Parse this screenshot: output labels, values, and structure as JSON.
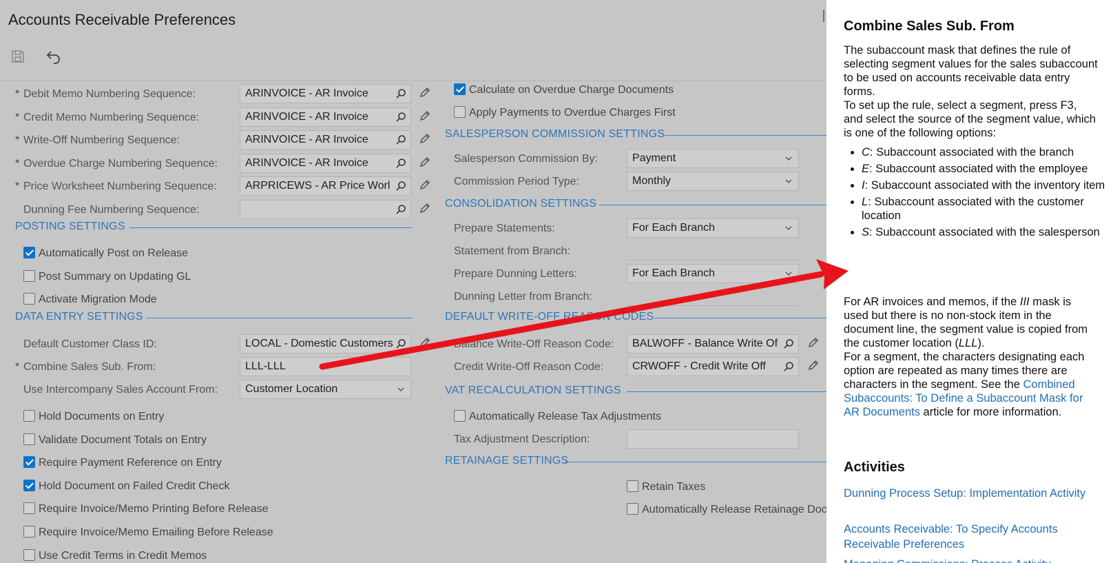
{
  "page": {
    "title": "Accounts Receivable Preferences"
  },
  "toolbar": {
    "save_icon": "save-icon",
    "undo_icon": "undo-icon"
  },
  "numbering": [
    {
      "label": "Debit Memo Numbering Sequence:",
      "required": true,
      "value": "ARINVOICE - AR Invoice"
    },
    {
      "label": "Credit Memo Numbering Sequence:",
      "required": true,
      "value": "ARINVOICE - AR Invoice"
    },
    {
      "label": "Write-Off Numbering Sequence:",
      "required": true,
      "value": "ARINVOICE - AR Invoice"
    },
    {
      "label": "Overdue Charge Numbering Sequence:",
      "required": true,
      "value": "ARINVOICE - AR Invoice"
    },
    {
      "label": "Price Worksheet Numbering Sequence:",
      "required": true,
      "value": "ARPRICEWS - AR Price Worl"
    },
    {
      "label": "Dunning Fee Numbering Sequence:",
      "required": false,
      "value": ""
    }
  ],
  "posting": {
    "title": "POSTING SETTINGS",
    "items": [
      {
        "label": "Automatically Post on Release",
        "checked": true
      },
      {
        "label": "Post Summary on Updating GL",
        "checked": false
      },
      {
        "label": "Activate Migration Mode",
        "checked": false
      }
    ]
  },
  "data_entry": {
    "title": "DATA ENTRY SETTINGS",
    "default_class_label": "Default Customer Class ID:",
    "default_class_value": "LOCAL - Domestic Customers",
    "combine_label": "Combine Sales Sub. From:",
    "combine_value": "LLL-LLL",
    "intercompany_label": "Use Intercompany Sales Account From:",
    "intercompany_value": "Customer Location",
    "checks": [
      {
        "label": "Hold Documents on Entry",
        "checked": false
      },
      {
        "label": "Validate Document Totals on Entry",
        "checked": false
      },
      {
        "label": "Require Payment Reference on Entry",
        "checked": true
      },
      {
        "label": "Hold Document on Failed Credit Check",
        "checked": true
      },
      {
        "label": "Require Invoice/Memo Printing Before Release",
        "checked": false
      },
      {
        "label": "Require Invoice/Memo Emailing Before Release",
        "checked": false
      },
      {
        "label": "Use Credit Terms in Credit Memos",
        "checked": false
      }
    ]
  },
  "overdue": {
    "calc_label": "Calculate on Overdue Charge Documents",
    "calc_checked": true,
    "apply_label": "Apply Payments to Overdue Charges First",
    "apply_checked": false
  },
  "commission": {
    "title": "SALESPERSON COMMISSION SETTINGS",
    "by_label": "Salesperson Commission By:",
    "by_value": "Payment",
    "period_label": "Commission Period Type:",
    "period_value": "Monthly"
  },
  "consolidation": {
    "title": "CONSOLIDATION SETTINGS",
    "prepare_label": "Prepare Statements:",
    "prepare_value": "For Each Branch",
    "stmt_branch_label": "Statement from Branch:",
    "dunning_label": "Prepare Dunning Letters:",
    "dunning_value": "For Each Branch",
    "dun_branch_label": "Dunning Letter from Branch:"
  },
  "writeoff": {
    "title": "DEFAULT WRITE-OFF REASON CODES",
    "balance_label": "Balance Write-Off Reason Code:",
    "balance_value": "BALWOFF - Balance Write Of",
    "credit_label": "Credit Write-Off Reason Code:",
    "credit_value": "CRWOFF - Credit Write Off"
  },
  "vat": {
    "title": "VAT RECALCULATION SETTINGS",
    "auto_label": "Automatically Release Tax Adjustments",
    "auto_checked": false,
    "desc_label": "Tax Adjustment Description:"
  },
  "retainage": {
    "title": "RETAINAGE SETTINGS",
    "retain_label": "Retain Taxes",
    "retain_checked": false,
    "auto_label": "Automatically Release Retainage Doc",
    "auto_checked": false
  },
  "help": {
    "title": "Combine Sales Sub. From",
    "intro": "The subaccount mask that defines the rule of selecting segment values for the sales subaccount to be used on accounts receivable data entry forms.",
    "setup": "To set up the rule, select a segment, press F3, and select the source of the segment value, which is one of the following options:",
    "options": [
      {
        "code": "C",
        "text": ": Subaccount associated with the branch"
      },
      {
        "code": "E",
        "text": ": Subaccount associated with the employee"
      },
      {
        "code": "I",
        "text": ": Subaccount associated with the inventory item"
      },
      {
        "code": "L",
        "text": ": Subaccount associated with the customer location"
      },
      {
        "code": "S",
        "text": ": Subaccount associated with the salesperson"
      }
    ],
    "ar_note_a": "For AR invoices and memos, if the ",
    "ar_note_mask": "III",
    "ar_note_b": " mask is used but there is no non-stock item in the document line, the segment value is copied from the customer location (",
    "ar_note_lll": "LLL",
    "ar_note_c": ").",
    "segment_note": "For a segment, the characters designating each option are repeated as many times there are characters in the segment. See the ",
    "link": "Combined Subaccounts: To Define a Subaccount Mask for AR Documents",
    "link_after": " article for more information.",
    "activities_title": "Activities",
    "activities": [
      "Dunning Process Setup: Implementation Activity",
      "Accounts Receivable: To Specify Accounts Receivable Preferences",
      "Managing Commissions: Process Activity"
    ]
  },
  "colors": {
    "accent": "#2e75b8",
    "check": "#0e73c6",
    "arrow": "#e8141c"
  }
}
